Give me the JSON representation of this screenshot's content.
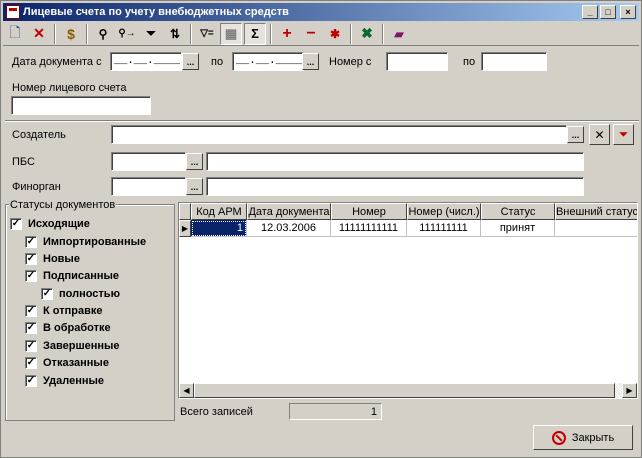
{
  "window": {
    "title": "Лицевые счета по учету внебюджетных средств"
  },
  "title_buttons": {
    "minimize": "_",
    "maximize": "□",
    "close": "×"
  },
  "toolbar": {
    "icons": [
      "new-document-icon",
      "delete-icon",
      "money-icon",
      "find-icon",
      "find-next-icon",
      "filter-icon",
      "sort-icon",
      "filter-settings-icon",
      "grid-settings-icon",
      "sum-icon",
      "add-icon",
      "remove-icon",
      "asterisk-icon",
      "excel-export-icon",
      "book-icon"
    ],
    "glyphs": {
      "new": "🗋",
      "delete": "✕",
      "money": "$",
      "find": "⚲",
      "find_next": "⚲→",
      "filter": "⏷",
      "sort": "⇅",
      "filter_eq": "▽=",
      "grid": "▦",
      "sum": "Σ",
      "add": "+",
      "remove": "−",
      "asterisk": "✱",
      "excel": "✖",
      "book": "▰"
    }
  },
  "filters": {
    "date_from_label": "Дата документа с",
    "date_from_value": "__.__.____",
    "date_to_label": "по",
    "date_to_value": "__.__.____",
    "number_from_label": "Номер с",
    "number_from_value": "",
    "number_to_label": "по",
    "number_to_value": "",
    "account_label": "Номер лицевого счета",
    "account_value": "",
    "dots": "...",
    "creator_label": "Создатель",
    "creator_value": "",
    "pbs_label": "ПБС",
    "pbs_code": "",
    "pbs_name": "",
    "finorgan_label": "Финорган",
    "finorgan_code": "",
    "finorgan_name": "",
    "clear_glyph": "✕",
    "clear_filter_glyph": "⏷"
  },
  "status_group": {
    "title": "Статусы документов",
    "items": [
      {
        "label": "Исходящие",
        "checked": "✓"
      },
      {
        "label": "Импортированные",
        "checked": "✓"
      },
      {
        "label": "Новые",
        "checked": "✓"
      },
      {
        "label": "Подписанные",
        "checked": "✓"
      },
      {
        "label": "полностью",
        "checked": "✓"
      },
      {
        "label": "К отправке",
        "checked": "✓"
      },
      {
        "label": "В обработке",
        "checked": "✓"
      },
      {
        "label": "Завершенные",
        "checked": "✓"
      },
      {
        "label": "Отказанные",
        "checked": "✓"
      },
      {
        "label": "Удаленные",
        "checked": "✓"
      }
    ]
  },
  "grid": {
    "columns": [
      "Код АРМ",
      "Дата документа",
      "Номер",
      "Номер (числ.)",
      "Статус",
      "Внешний статус"
    ],
    "rows": [
      {
        "indicator": "▶",
        "cells": [
          "1",
          "12.03.2006",
          "11111111111",
          "111111111",
          "принят",
          ""
        ]
      }
    ],
    "scroll_left": "◀",
    "scroll_right": "▶"
  },
  "footer": {
    "total_label": "Всего записей",
    "total_value": "1",
    "close_label": "Закрыть"
  }
}
